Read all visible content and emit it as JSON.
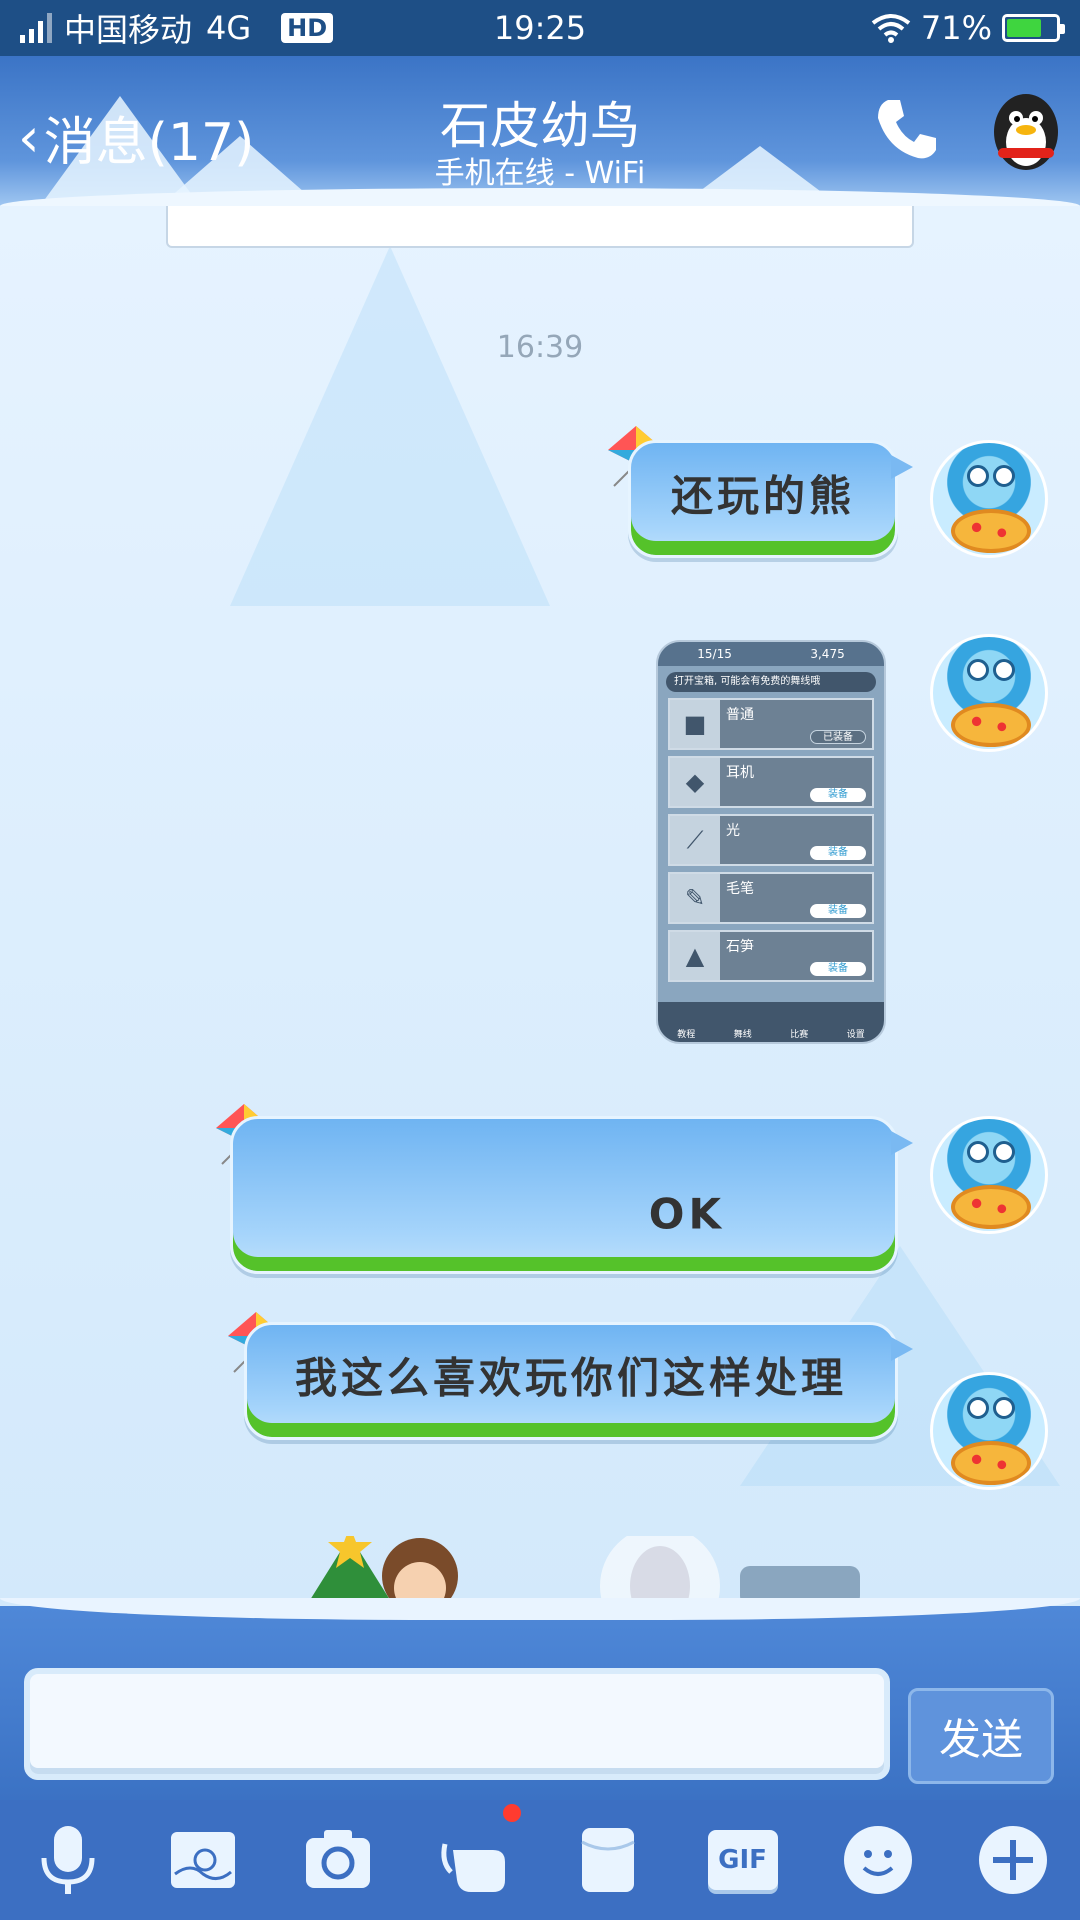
{
  "status": {
    "carrier": "中国移动",
    "network": "4G",
    "hd": "HD",
    "time": "19:25",
    "battery": "71%",
    "battery_level": 0.71
  },
  "header": {
    "back_label": "消息(17)",
    "title": "石皮幼鸟",
    "subtitle": "手机在线 - WiFi"
  },
  "chat": {
    "timestamp": "16:39",
    "messages": [
      {
        "type": "text",
        "text": "还玩的熊"
      },
      {
        "type": "image",
        "game": {
          "top_left": "15/15",
          "top_right": "3,475",
          "banner": "打开宝箱, 可能会有免费的舞线哦",
          "items": [
            {
              "name": "普通",
              "action": "已装备"
            },
            {
              "name": "耳机",
              "action": "装备"
            },
            {
              "name": "光",
              "action": "装备"
            },
            {
              "name": "毛笔",
              "action": "装备"
            },
            {
              "name": "石笋",
              "action": "装备"
            }
          ],
          "nav": [
            "教程",
            "舞线",
            "比赛",
            "设置"
          ]
        }
      },
      {
        "type": "text",
        "text": "OK"
      },
      {
        "type": "text",
        "text": "我这么喜欢玩你们这样处理"
      }
    ]
  },
  "input": {
    "value": "",
    "placeholder": "",
    "send_label": "发送"
  },
  "toolbar": {
    "items": [
      "microphone-icon",
      "photo-icon",
      "camera-icon",
      "red-packet-icon",
      "file-icon",
      "gif-icon",
      "emoji-icon",
      "plus-icon"
    ],
    "gif_label": "GIF"
  },
  "colors": {
    "header": "#3b74c6",
    "bubble": "#8cc6f6",
    "accent_green": "#55c22a",
    "toolbar": "#3c6fc2"
  }
}
